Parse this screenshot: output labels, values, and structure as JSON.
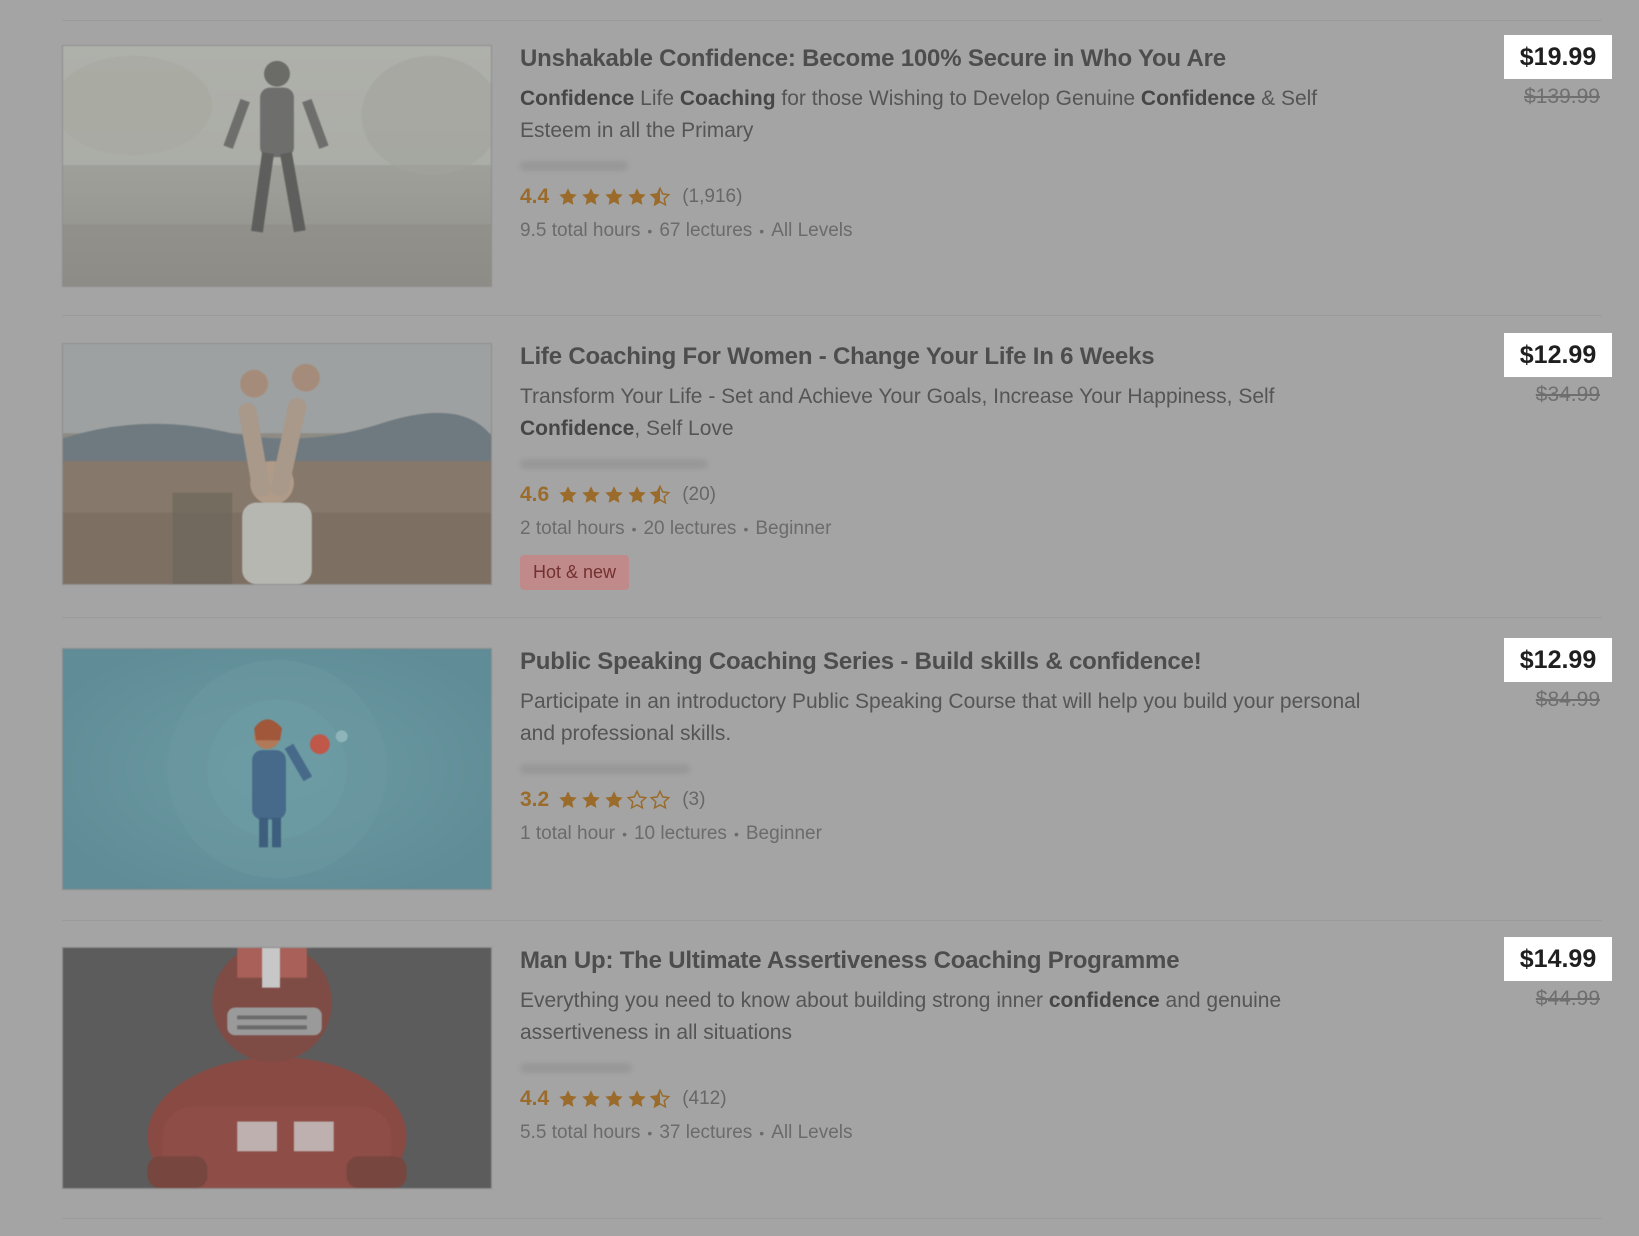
{
  "colors": {
    "overlay_background": "#a4a4a4",
    "rating": "#9a6b2a",
    "badge_bg": "#c08a8a",
    "badge_text": "#733030",
    "price_box": "#ffffff"
  },
  "courses": [
    {
      "title": "Unshakable Confidence: Become 100% Secure in Who You Are",
      "headline": [
        {
          "text": "Confidence",
          "bold": true
        },
        {
          "text": " Life ",
          "bold": false
        },
        {
          "text": "Coaching",
          "bold": true
        },
        {
          "text": " for those Wishing to Develop Genuine ",
          "bold": false
        },
        {
          "text": "Confidence",
          "bold": true
        },
        {
          "text": " & Self Esteem in all the Primary",
          "bold": false
        }
      ],
      "rating": "4.4",
      "stars": [
        1,
        1,
        1,
        1,
        0.5
      ],
      "rating_count": "(1,916)",
      "hours": "9.5 total hours",
      "lectures": "67 lectures",
      "level": "All Levels",
      "badge": "",
      "price": "$19.99",
      "original_price": "$139.99",
      "thumbnail_icon": "person-walking-thumbnail"
    },
    {
      "title": "Life Coaching For Women - Change Your Life In 6 Weeks",
      "headline": [
        {
          "text": "Transform Your Life - Set and Achieve Your Goals, Increase Your Happiness, Self ",
          "bold": false
        },
        {
          "text": "Confidence",
          "bold": true
        },
        {
          "text": ", Self Love",
          "bold": false
        }
      ],
      "rating": "4.6",
      "stars": [
        1,
        1,
        1,
        1,
        0.5
      ],
      "rating_count": "(20)",
      "hours": "2 total hours",
      "lectures": "20 lectures",
      "level": "Beginner",
      "badge": "Hot & new",
      "price": "$12.99",
      "original_price": "$34.99",
      "thumbnail_icon": "woman-arms-raised-thumbnail"
    },
    {
      "title": "Public Speaking Coaching Series - Build skills & confidence!",
      "headline": [
        {
          "text": "Participate in an introductory Public Speaking Course that will help you build your personal and professional skills.",
          "bold": false
        }
      ],
      "rating": "3.2",
      "stars": [
        1,
        1,
        1,
        0,
        0
      ],
      "rating_count": "(3)",
      "hours": "1 total hour",
      "lectures": "10 lectures",
      "level": "Beginner",
      "badge": "",
      "price": "$12.99",
      "original_price": "$84.99",
      "thumbnail_icon": "speaker-illustration-thumbnail"
    },
    {
      "title": "Man Up: The Ultimate Assertiveness Coaching Programme",
      "headline": [
        {
          "text": "Everything you need to know about building strong inner ",
          "bold": false
        },
        {
          "text": "confidence",
          "bold": true
        },
        {
          "text": " and genuine assertiveness in all situations",
          "bold": false
        }
      ],
      "rating": "4.4",
      "stars": [
        1,
        1,
        1,
        1,
        0.5
      ],
      "rating_count": "(412)",
      "hours": "5.5 total hours",
      "lectures": "37 lectures",
      "level": "All Levels",
      "badge": "",
      "price": "$14.99",
      "original_price": "$44.99",
      "thumbnail_icon": "football-player-thumbnail"
    }
  ],
  "meta_separator": "•"
}
